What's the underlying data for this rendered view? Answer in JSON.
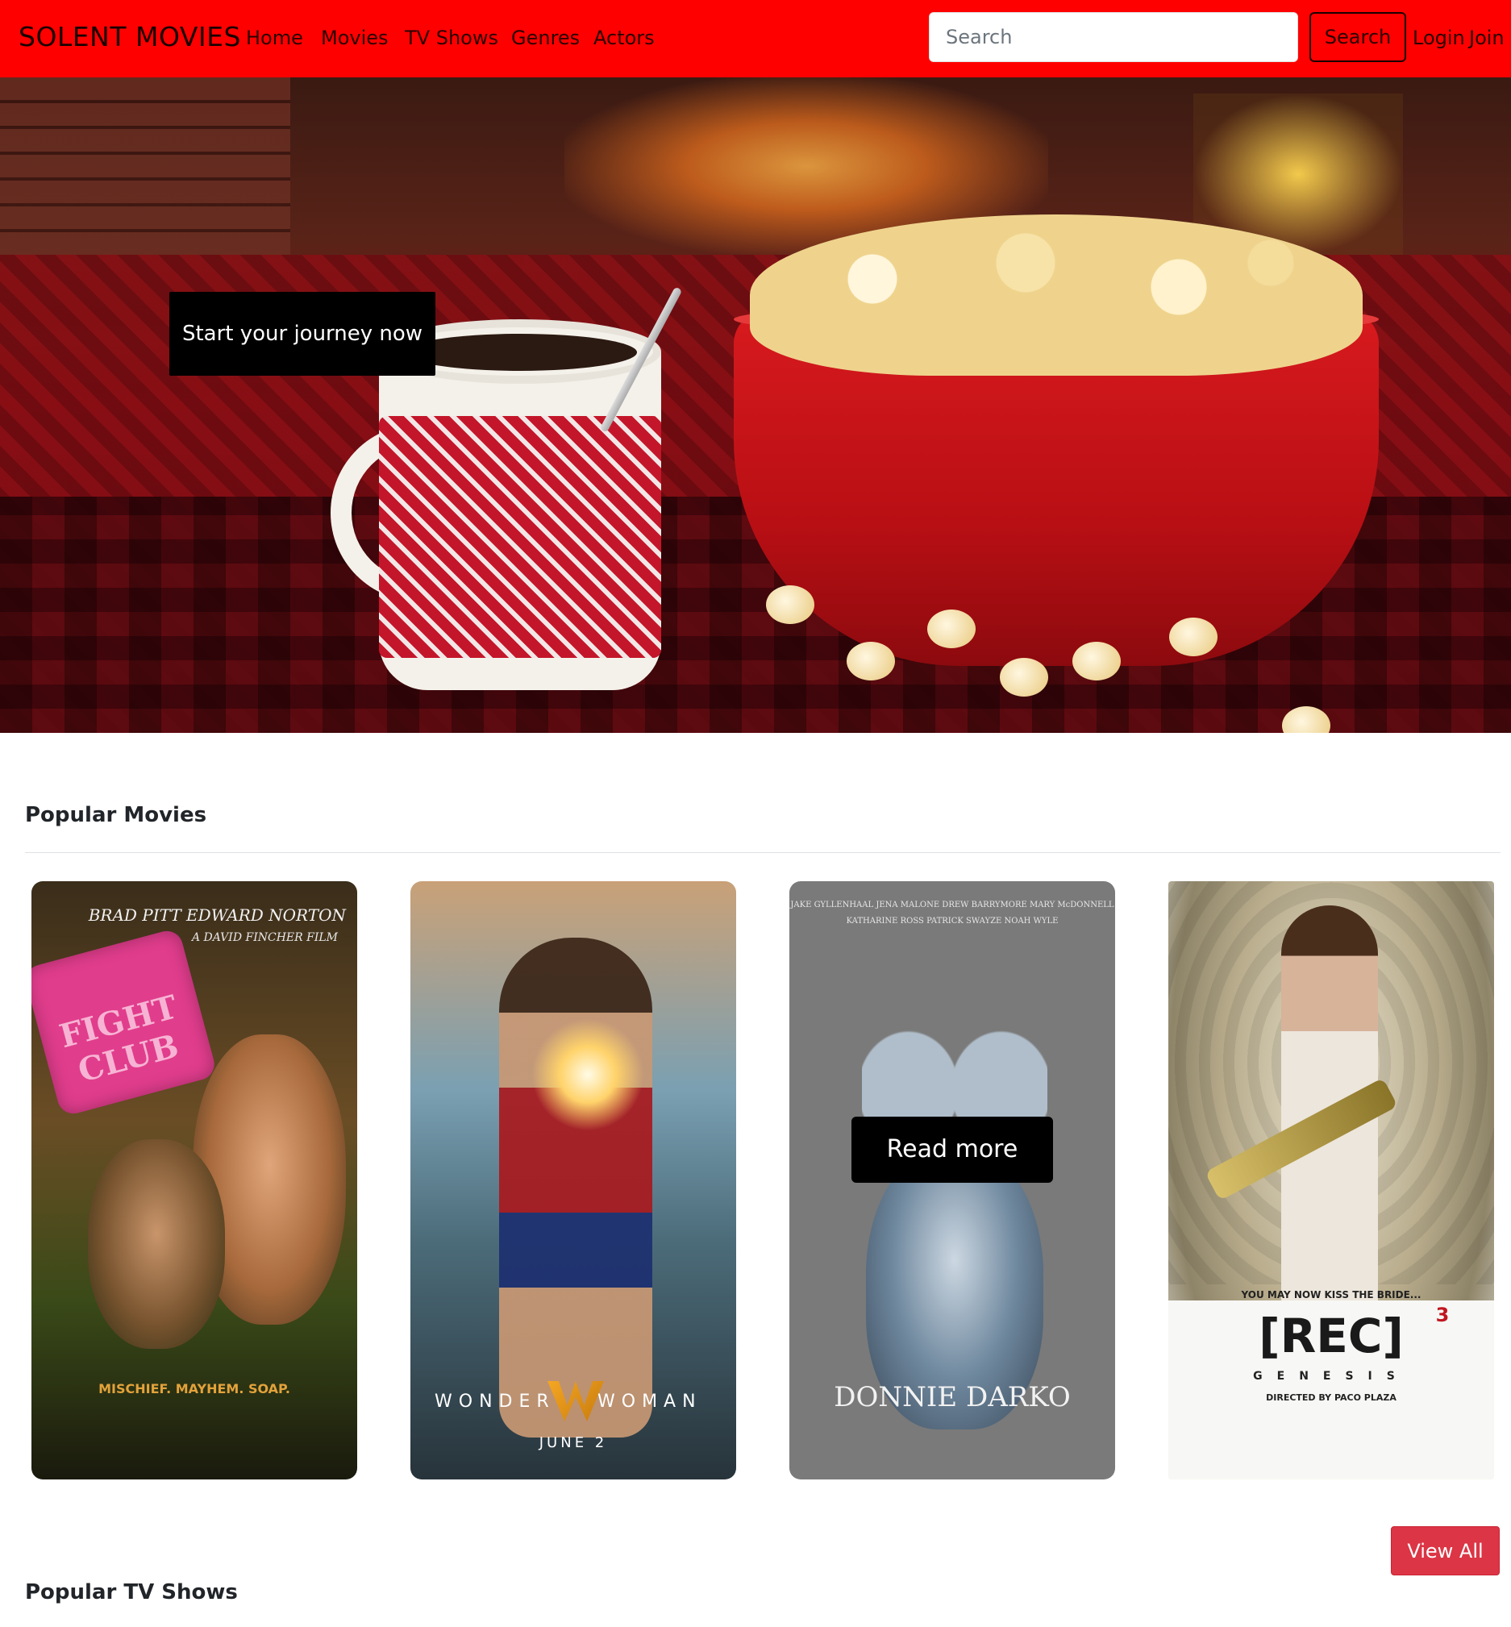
{
  "nav": {
    "brand": "SOLENT MOVIES",
    "links": [
      "Home",
      "Movies",
      "TV Shows",
      "Genres",
      "Actors"
    ],
    "search_placeholder": "Search",
    "search_button": "Search",
    "login": "Login",
    "join": "Join"
  },
  "hero": {
    "cta": "Start your journey now"
  },
  "popular_movies": {
    "title": "Popular Movies",
    "movies": [
      {
        "name": "Fight Club",
        "poster_text": [
          "BRAD PITT  EDWARD NORTON",
          "A DAVID FINCHER FILM",
          "FIGHT CLUB",
          "MISCHIEF. MAYHEM. SOAP."
        ]
      },
      {
        "name": "Wonder Woman",
        "poster_text": [
          "WONDER",
          "WOMAN",
          "JUNE 2"
        ]
      },
      {
        "name": "Donnie Darko",
        "poster_text": [
          "JAKE GYLLENHAAL  JENA MALONE  DREW BARRYMORE  MARY McDONNELL",
          "KATHARINE ROSS  PATRICK SWAYZE  NOAH WYLE",
          "DONNIE DARKO"
        ],
        "overlay_button": "Read more"
      },
      {
        "name": "[REC] 3 Genesis",
        "poster_text": [
          "YOU MAY NOW KISS THE BRIDE...",
          "[REC]",
          "3",
          "GENESIS",
          "DIRECTED BY PACO PLAZA"
        ]
      }
    ],
    "view_all": "View All"
  },
  "popular_tv": {
    "title": "Popular TV Shows"
  },
  "colors": {
    "navbar": "#ff0000",
    "view_all": "#dc3545"
  }
}
